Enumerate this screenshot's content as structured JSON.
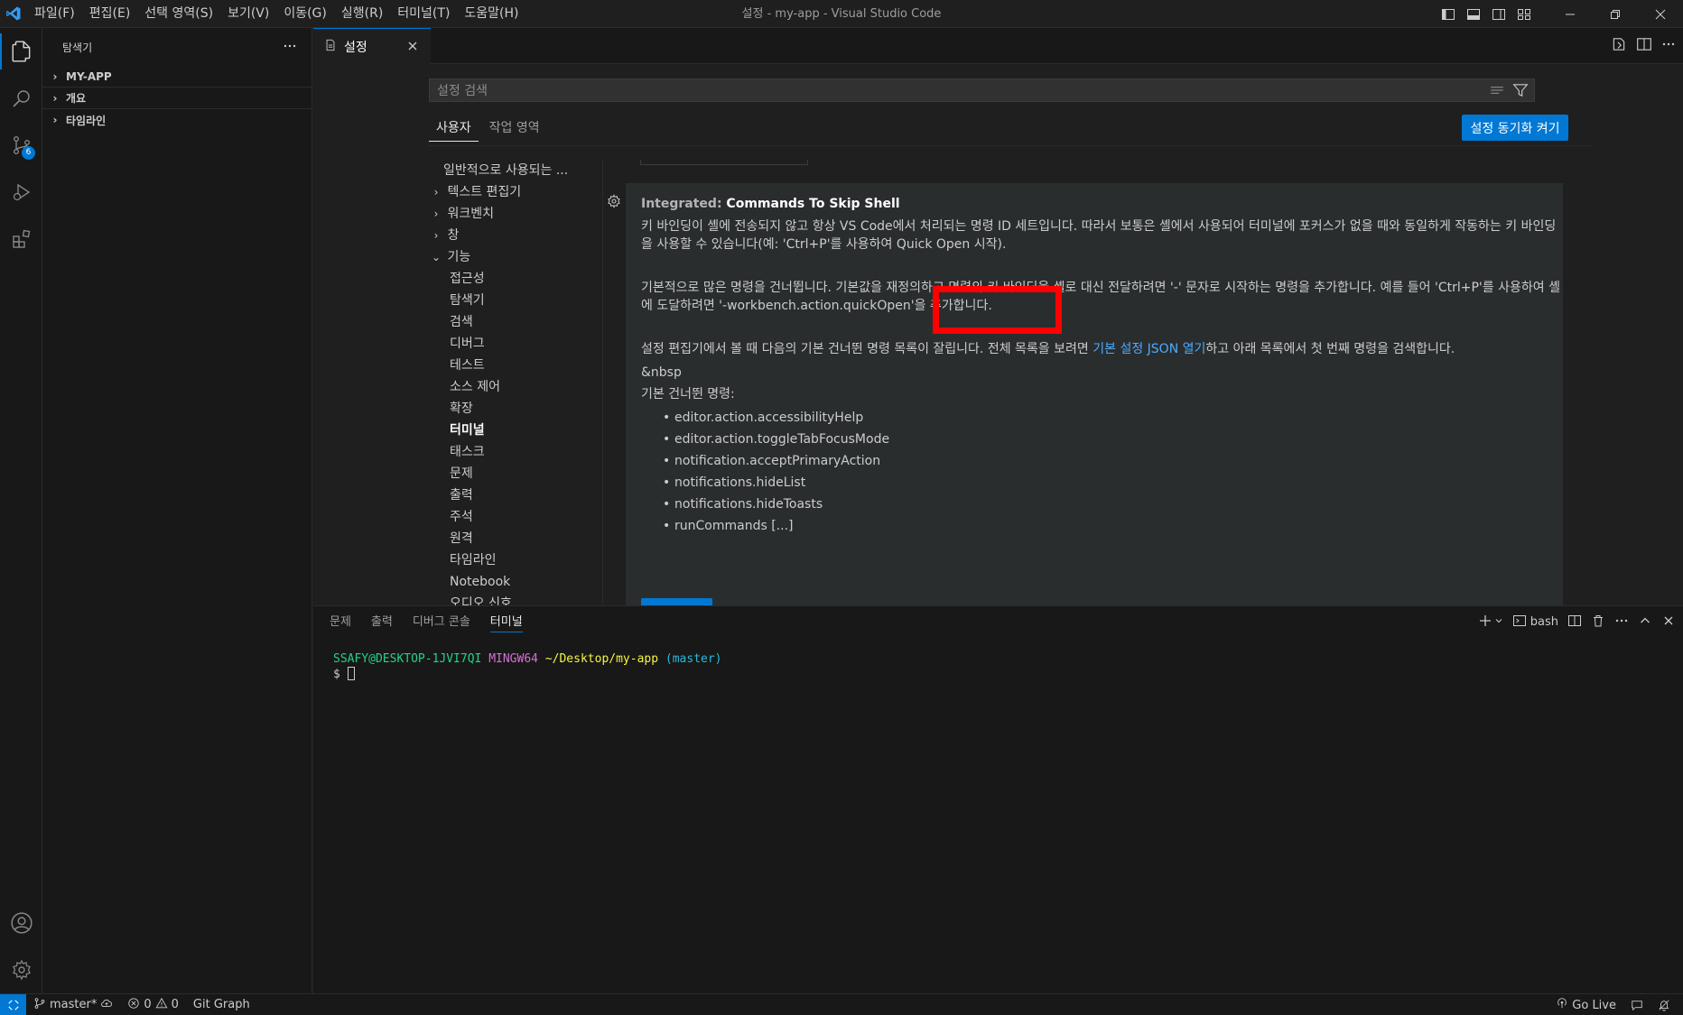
{
  "window": {
    "title": "설정 - my-app - Visual Studio Code",
    "menu": [
      "파일(F)",
      "편집(E)",
      "선택 영역(S)",
      "보기(V)",
      "이동(G)",
      "실행(R)",
      "터미널(T)",
      "도움말(H)"
    ]
  },
  "activity": {
    "scm_badge": "6"
  },
  "sidebar": {
    "header": "탐색기",
    "sections": [
      {
        "label": "MY-APP"
      },
      {
        "label": "개요"
      },
      {
        "label": "타임라인"
      }
    ]
  },
  "editor": {
    "tab_label": "설정"
  },
  "settings": {
    "search_placeholder": "설정 검색",
    "scope_tabs": [
      "사용자",
      "작업 영역"
    ],
    "sync_button": "설정 동기화 켜기",
    "toc": [
      {
        "label": "일반적으로 사용되는 ...",
        "chevron": ""
      },
      {
        "label": "텍스트 편집기",
        "chevron": ">"
      },
      {
        "label": "워크벤치",
        "chevron": ">"
      },
      {
        "label": "창",
        "chevron": ">"
      },
      {
        "label": "기능",
        "chevron": "v"
      },
      {
        "label": "접근성",
        "chevron": ""
      },
      {
        "label": "탐색기",
        "chevron": ""
      },
      {
        "label": "검색",
        "chevron": ""
      },
      {
        "label": "디버그",
        "chevron": ""
      },
      {
        "label": "테스트",
        "chevron": ""
      },
      {
        "label": "소스 제어",
        "chevron": ""
      },
      {
        "label": "확장",
        "chevron": ""
      },
      {
        "label": "터미널",
        "chevron": ""
      },
      {
        "label": "태스크",
        "chevron": ""
      },
      {
        "label": "문제",
        "chevron": ""
      },
      {
        "label": "출력",
        "chevron": ""
      },
      {
        "label": "주석",
        "chevron": ""
      },
      {
        "label": "원격",
        "chevron": ""
      },
      {
        "label": "타임라인",
        "chevron": ""
      },
      {
        "label": "Notebook",
        "chevron": ""
      },
      {
        "label": "오디오 신호",
        "chevron": ""
      }
    ],
    "setting": {
      "category": "Integrated: ",
      "name": "Commands To Skip Shell",
      "para1": "키 바인딩이 셸에 전송되지 않고 항상 VS Code에서 처리되는 명령 ID 세트입니다. 따라서 보통은 셸에서 사용되어 터미널에 포커스가 없을 때와 동일하게 작동하는 키 바인딩을 사용할 수 있습니다(예: 'Ctrl+P'를 사용하여 Quick Open 시작).",
      "para2": "기본적으로 많은 명령을 건너뜁니다. 기본값을 재정의하고 명령의 키 바인딩을 셸로 대신 전달하려면 '-' 문자로 시작하는 명령을 추가합니다. 예를 들어 'Ctrl+P'를 사용하여 셸에 도달하려면 '-workbench.action.quickOpen'을 추가합니다.",
      "para3_before": "설정 편집기에서 볼 때 다음의 기본 건너뛴 명령 목록이 잘립니다. 전체 목록을 보려면 ",
      "para3_link": "기본 설정 JSON 열기",
      "para3_after": "하고 아래 목록에서 첫 번째 명령을 검색합니다.",
      "nbsp_text": "&nbsp",
      "list_heading": "기본 건너뛴 명령:",
      "commands": [
        "editor.action.accessibilityHelp",
        "editor.action.toggleTabFocusMode",
        "notification.acceptPrimaryAction",
        "notifications.hideList",
        "notifications.hideToasts",
        "runCommands [...]"
      ]
    }
  },
  "panel": {
    "tabs": [
      "문제",
      "출력",
      "디버그 콘솔",
      "터미널"
    ],
    "active_tab": "터미널",
    "shell_label": "bash",
    "terminal": {
      "user_host": "SSAFY@DESKTOP-1JVI7QI",
      "system": "MINGW64",
      "path": "~/Desktop/my-app",
      "branch": "(master)",
      "prompt": "$ "
    }
  },
  "statusbar": {
    "branch": "master*",
    "errors": "0",
    "warnings": "0",
    "git_graph": "Git Graph",
    "go_live": "Go Live"
  },
  "colors": {
    "accent": "#0078d4",
    "highlight": "#ff0000",
    "link": "#4daafc"
  }
}
